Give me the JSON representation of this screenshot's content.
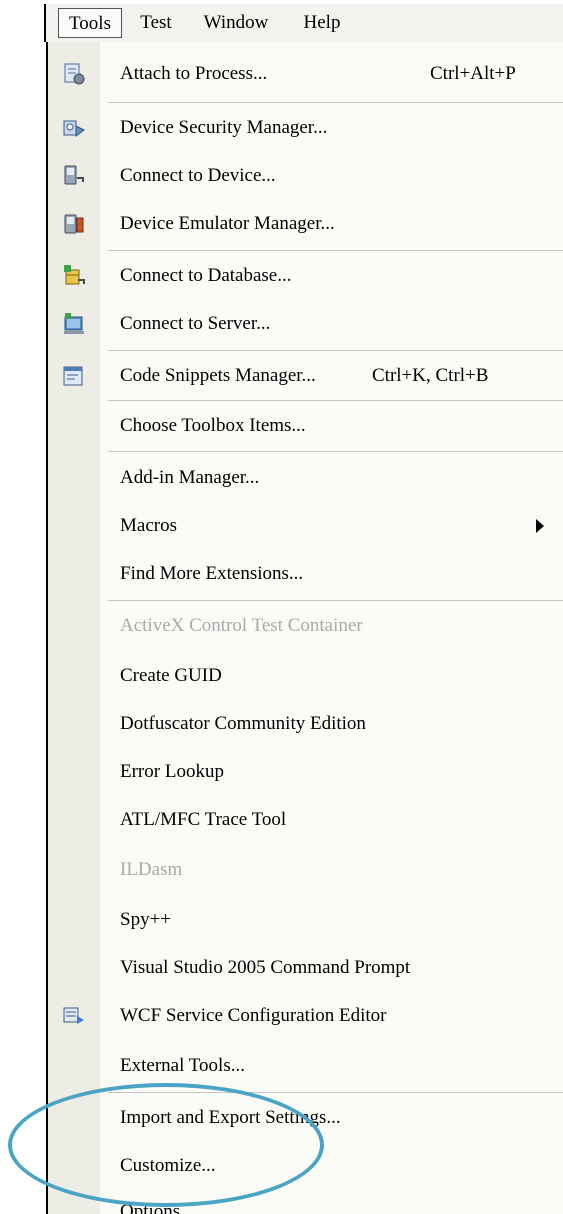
{
  "menubar": {
    "items": [
      {
        "label": "Tools",
        "open": true
      },
      {
        "label": "Test",
        "open": false
      },
      {
        "label": "Window",
        "open": false
      },
      {
        "label": "Help",
        "open": false
      }
    ]
  },
  "menu": {
    "items": [
      {
        "label": "Attach to Process...",
        "shortcut": "Ctrl+Alt+P",
        "icon": "attach-process-icon"
      },
      {
        "label": "Device Security Manager...",
        "icon": "device-security-icon"
      },
      {
        "label": "Connect to Device...",
        "icon": "connect-device-icon"
      },
      {
        "label": "Device Emulator Manager...",
        "icon": "device-emulator-icon"
      },
      {
        "label": "Connect to Database...",
        "icon": "connect-database-icon"
      },
      {
        "label": "Connect to Server...",
        "icon": "connect-server-icon"
      },
      {
        "label": "Code Snippets Manager...",
        "shortcut": "Ctrl+K, Ctrl+B",
        "icon": "code-snippets-icon"
      },
      {
        "label": "Choose Toolbox Items..."
      },
      {
        "label": "Add-in Manager..."
      },
      {
        "label": "Macros",
        "submenu": true
      },
      {
        "label": "Find More Extensions..."
      },
      {
        "label": "ActiveX Control Test Container",
        "disabled": true
      },
      {
        "label": "Create GUID"
      },
      {
        "label": "Dotfuscator Community Edition"
      },
      {
        "label": "Error Lookup"
      },
      {
        "label": "ATL/MFC Trace Tool"
      },
      {
        "label": "ILDasm",
        "disabled": true
      },
      {
        "label": "Spy++"
      },
      {
        "label": "Visual Studio 2005 Command Prompt"
      },
      {
        "label": "WCF Service Configuration Editor",
        "icon": "wcf-config-icon"
      },
      {
        "label": "External Tools..."
      },
      {
        "label": "Import and Export Settings..."
      },
      {
        "label": "Customize..."
      },
      {
        "label": "Options..."
      }
    ]
  },
  "colors": {
    "highlight_ellipse": "#4aa5c4",
    "gutter": "#eeede5",
    "disabled_text": "#a9a9a9"
  }
}
